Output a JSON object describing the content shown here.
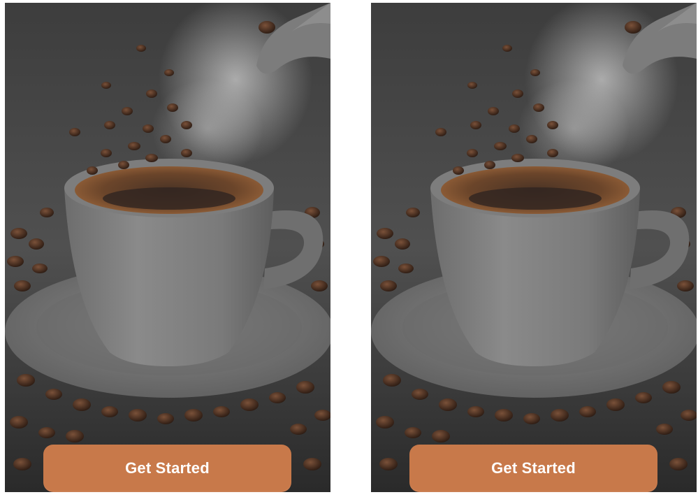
{
  "theme": {
    "accent": "#c8794a",
    "background": "#ffffff"
  },
  "screens": [
    {
      "hero_image": "coffee-cup-with-falling-beans",
      "cta_label": "Get Started"
    },
    {
      "hero_image": "coffee-cup-with-falling-beans",
      "cta_label": "Get Started"
    }
  ]
}
